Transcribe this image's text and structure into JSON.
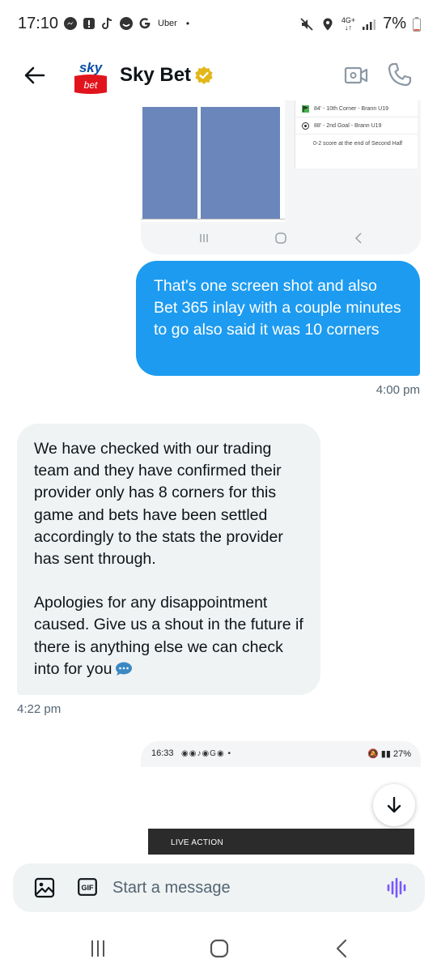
{
  "status_bar": {
    "time": "17:10",
    "app_label": "Uber",
    "dot": "•",
    "network": "4G+",
    "battery": "7%"
  },
  "header": {
    "avatar_top": "sky",
    "avatar_bottom": "bet",
    "contact_name": "Sky Bet"
  },
  "shared_screenshot_1": {
    "events": [
      "84' - 10th Corner - Brann U19",
      "88' - 2nd Goal - Brann U19"
    ],
    "summary": "0-2 score at the end of Second Half"
  },
  "messages": [
    {
      "direction": "outgoing",
      "text": "That's one screen shot and also Bet 365 inlay with a couple minutes to go also said it was 10 corners",
      "time": "4:00 pm"
    },
    {
      "direction": "incoming",
      "paragraphs": [
        "We have checked with our trading team and they have confirmed their provider only has 8 corners for this game and bets have been settled accordingly to the stats the provider has sent through.",
        "Apologies for any disappointment caused. Give us a shout in the future if there is anything else we can check into for you"
      ],
      "time": "4:22 pm"
    }
  ],
  "shared_screenshot_2": {
    "time": "16:33",
    "battery": "27%",
    "live_label": "LIVE ACTION"
  },
  "composer": {
    "placeholder": "Start a message",
    "gif_label": "GIF"
  },
  "colors": {
    "outgoing_bubble": "#1d9bf0",
    "incoming_bubble": "#eff3f4",
    "secondary_text": "#536471",
    "voice_accent": "#7856ff",
    "brand_red": "#e1141e",
    "brand_blue": "#0b4ea2",
    "verified_gold": "#e2b719"
  }
}
